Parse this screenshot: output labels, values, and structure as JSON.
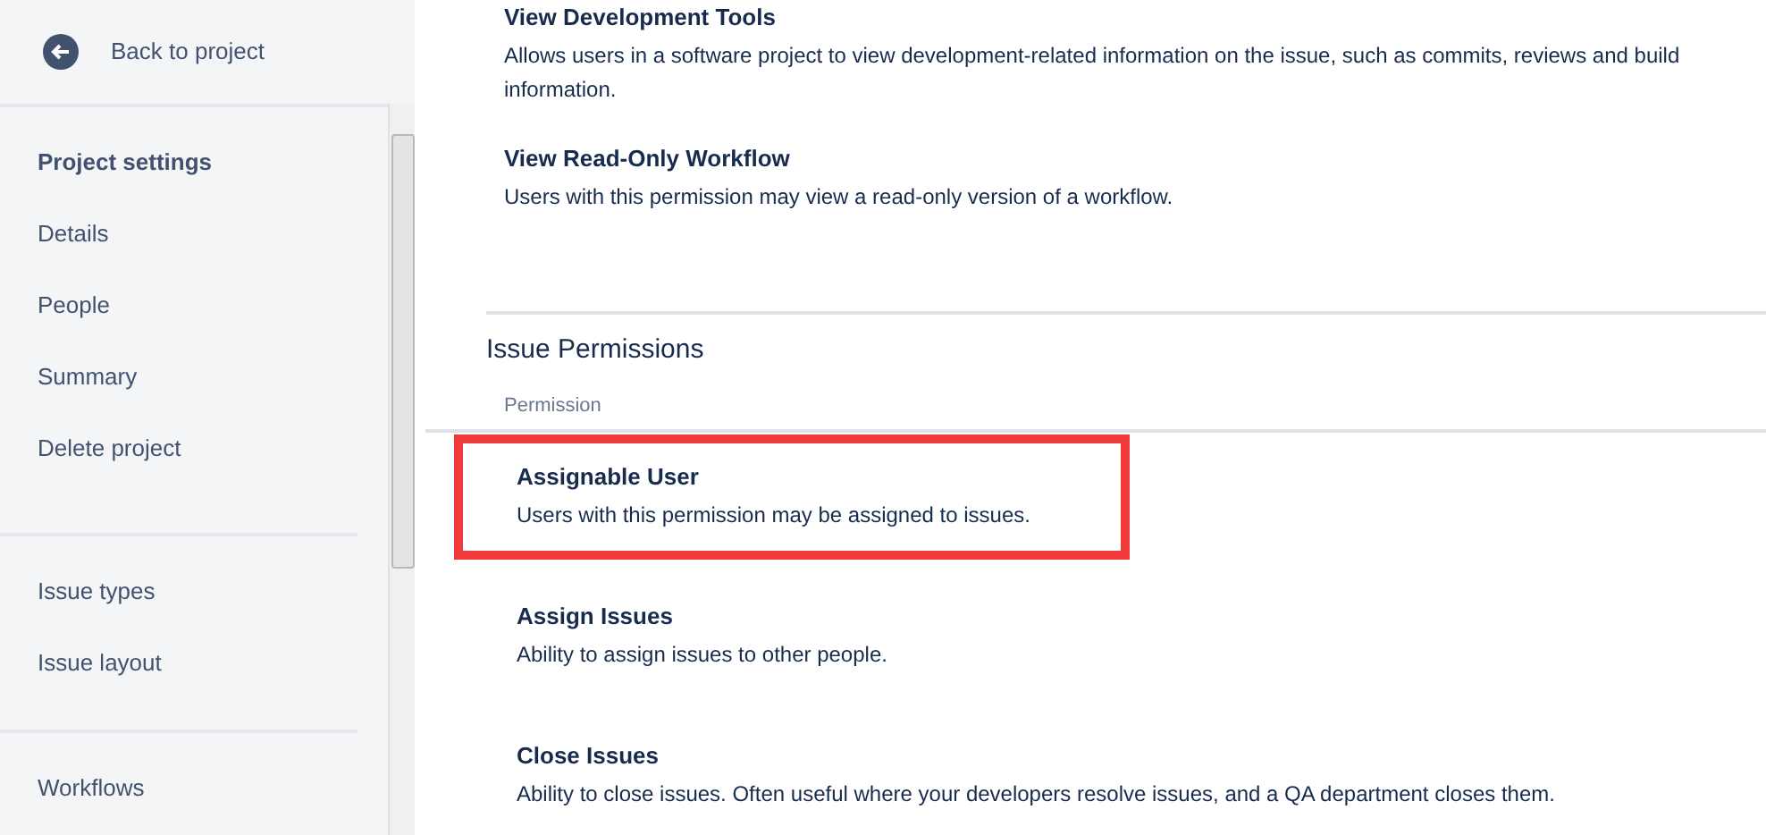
{
  "sidebar": {
    "back_link": "Back to project",
    "groups": [
      {
        "heading": "Project settings",
        "items": [
          "Details",
          "People",
          "Summary",
          "Delete project"
        ]
      },
      {
        "items": [
          "Issue types",
          "Issue layout"
        ]
      },
      {
        "items": [
          "Workflows"
        ]
      }
    ]
  },
  "top_permissions": [
    {
      "name": "View Development Tools",
      "description": "Allows users in a software project to view development-related information on the issue, such as commits, reviews and build information."
    },
    {
      "name": "View Read-Only Workflow",
      "description": "Users with this permission may view a read-only version of a workflow."
    }
  ],
  "section": {
    "title": "Issue Permissions",
    "column_header": "Permission",
    "permissions": [
      {
        "name": "Assignable User",
        "description": "Users with this permission may be assigned to issues.",
        "highlighted": true
      },
      {
        "name": "Assign Issues",
        "description": "Ability to assign issues to other people.",
        "highlighted": false
      },
      {
        "name": "Close Issues",
        "description": "Ability to close issues. Often useful where your developers resolve issues, and a QA department closes them.",
        "highlighted": false
      }
    ]
  }
}
